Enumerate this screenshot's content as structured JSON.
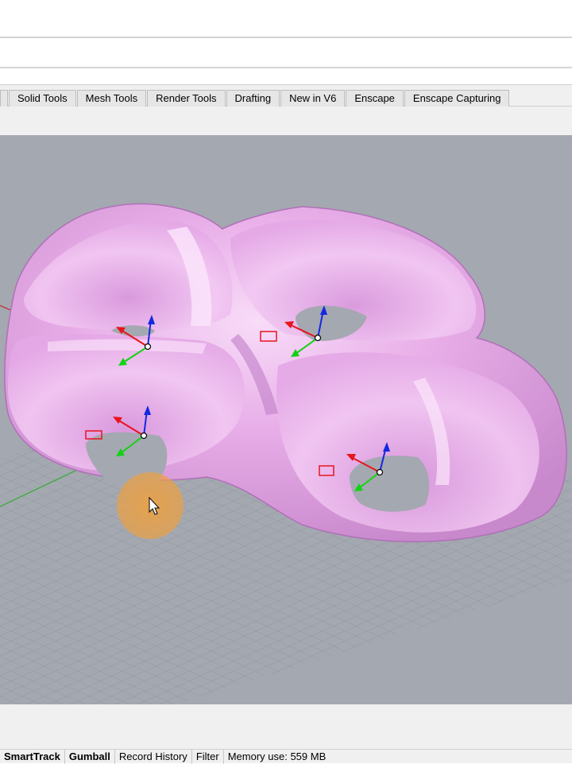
{
  "tabs": [
    {
      "label": "Solid Tools"
    },
    {
      "label": "Mesh Tools"
    },
    {
      "label": "Render Tools"
    },
    {
      "label": "Drafting"
    },
    {
      "label": "New in V6"
    },
    {
      "label": "Enscape"
    },
    {
      "label": "Enscape Capturing"
    }
  ],
  "status": {
    "smarttrack": "SmartTrack",
    "gumball": "Gumball",
    "record_history": "Record History",
    "filter": "Filter",
    "memory": "Memory use: 559 MB"
  },
  "colors": {
    "viewport_bg": "#a4a8b0",
    "surface": "#e9b0e9",
    "gumball_x": "#e8141e",
    "gumball_y": "#14d214",
    "gumball_z": "#1428e0",
    "cursor_highlight": "#f0a03c"
  }
}
